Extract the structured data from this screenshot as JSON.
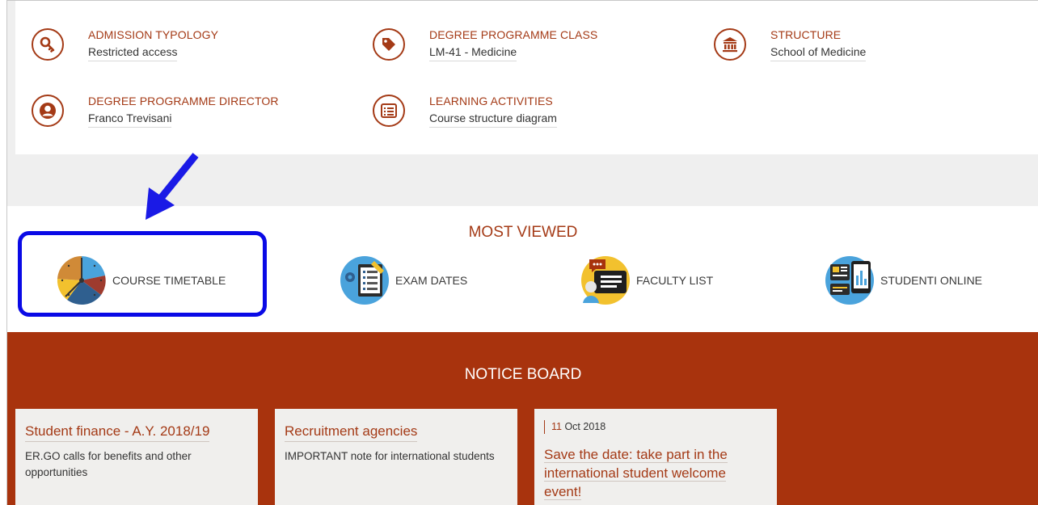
{
  "info": {
    "items": [
      {
        "label": "ADMISSION TYPOLOGY",
        "value": "Restricted access",
        "icon": "key-icon"
      },
      {
        "label": "DEGREE PROGRAMME CLASS",
        "value": "LM-41 - Medicine",
        "icon": "tag-icon"
      },
      {
        "label": "STRUCTURE",
        "value": "School of Medicine",
        "icon": "institution-icon"
      },
      {
        "label": "DEGREE PROGRAMME DIRECTOR",
        "value": "Franco Trevisani",
        "icon": "user-icon"
      },
      {
        "label": "LEARNING ACTIVITIES",
        "value": "Course structure diagram",
        "icon": "list-icon"
      }
    ]
  },
  "most_viewed": {
    "title": "MOST VIEWED",
    "items": [
      {
        "label": "COURSE TIMETABLE",
        "icon": "clock-icon"
      },
      {
        "label": "EXAM DATES",
        "icon": "exam-checklist-icon"
      },
      {
        "label": "FACULTY LIST",
        "icon": "faculty-chat-icon"
      },
      {
        "label": "STUDENTI ONLINE",
        "icon": "student-portal-icon"
      }
    ]
  },
  "notice_board": {
    "title": "NOTICE BOARD",
    "cards": [
      {
        "title": "Student finance - A.Y. 2018/19",
        "text": "ER.GO calls for benefits and other opportunities"
      },
      {
        "title": "Recruitment agencies",
        "text": "IMPORTANT note for international students"
      },
      {
        "day": "11",
        "date_rest": " Oct 2018",
        "lines": [
          "Save the date: take part in the",
          "international student welcome",
          "event!"
        ]
      }
    ]
  },
  "colors": {
    "accent": "#a43a16",
    "notice_bg": "#a8330d",
    "highlight": "#0a0ae6"
  }
}
